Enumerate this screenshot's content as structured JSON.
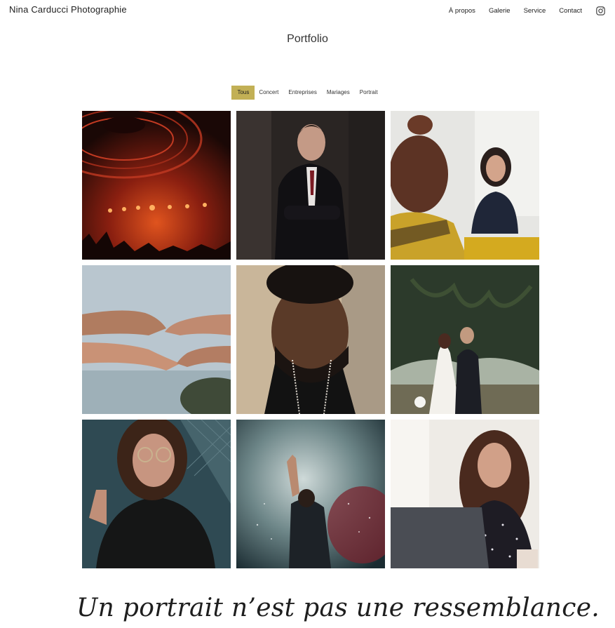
{
  "header": {
    "brand": "Nina Carducci Photographie",
    "nav": [
      "À propos",
      "Galerie",
      "Service",
      "Contact"
    ],
    "social_icon": "instagram-icon"
  },
  "gallery": {
    "title": "Portfolio",
    "filters": [
      {
        "label": "Tous",
        "active": true
      },
      {
        "label": "Concert",
        "active": false
      },
      {
        "label": "Entreprises",
        "active": false
      },
      {
        "label": "Mariages",
        "active": false
      },
      {
        "label": "Portrait",
        "active": false
      }
    ],
    "accent_color": "#c2b055",
    "photos": [
      {
        "subject": "concert-stage-lights"
      },
      {
        "subject": "businessman-portrait"
      },
      {
        "subject": "business-meeting"
      },
      {
        "subject": "reaching-hands"
      },
      {
        "subject": "man-closed-eyes-portrait"
      },
      {
        "subject": "wedding-couple"
      },
      {
        "subject": "woman-glasses-portrait"
      },
      {
        "subject": "concert-performer-smoke"
      },
      {
        "subject": "woman-laughing-laptop"
      }
    ]
  },
  "quote": {
    "text": "Un portrait n’est pas une ressemblance."
  }
}
